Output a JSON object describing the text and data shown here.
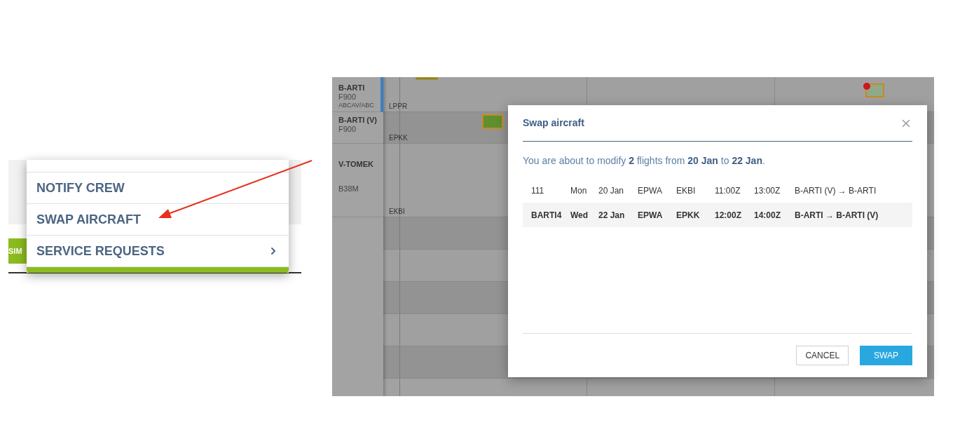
{
  "menu": {
    "side_button": "SIM",
    "items": [
      {
        "label": "NOTIFY CREW",
        "submenu": false
      },
      {
        "label": "SWAP AIRCRAFT",
        "submenu": false
      },
      {
        "label": "SERVICE REQUESTS",
        "submenu": true
      }
    ]
  },
  "scheduler": {
    "aircraft": [
      {
        "registration": "B-ARTI",
        "type": "F900",
        "note": "ABCAV/ABC",
        "selected": true
      },
      {
        "registration": "B-ARTI (V)",
        "type": "F900",
        "selected": false
      },
      {
        "registration": "V-TOMEK",
        "type": "B38M",
        "selected": false
      }
    ],
    "airports": [
      "LPPR",
      "EPKK",
      "EKBI"
    ]
  },
  "dialog": {
    "title": "Swap aircraft",
    "message": "You are about to modify **2** flights from **20 Jan** to **22 Jan**.",
    "flights": [
      {
        "number": "111",
        "day": "Mon",
        "date": "20 Jan",
        "from": "EPWA",
        "to": "EKBI",
        "departure": "11:00Z",
        "arrival": "13:00Z",
        "swap": "B-ARTI (V) → B-ARTI"
      },
      {
        "number": "BARTI4",
        "day": "Wed",
        "date": "22 Jan",
        "from": "EPWA",
        "to": "EPKK",
        "departure": "12:00Z",
        "arrival": "14:00Z",
        "swap": "B-ARTI → B-ARTI (V)"
      }
    ],
    "buttons": [
      {
        "label": "CANCEL",
        "kind": "secondary"
      },
      {
        "label": "SWAP",
        "kind": "primary"
      }
    ]
  }
}
